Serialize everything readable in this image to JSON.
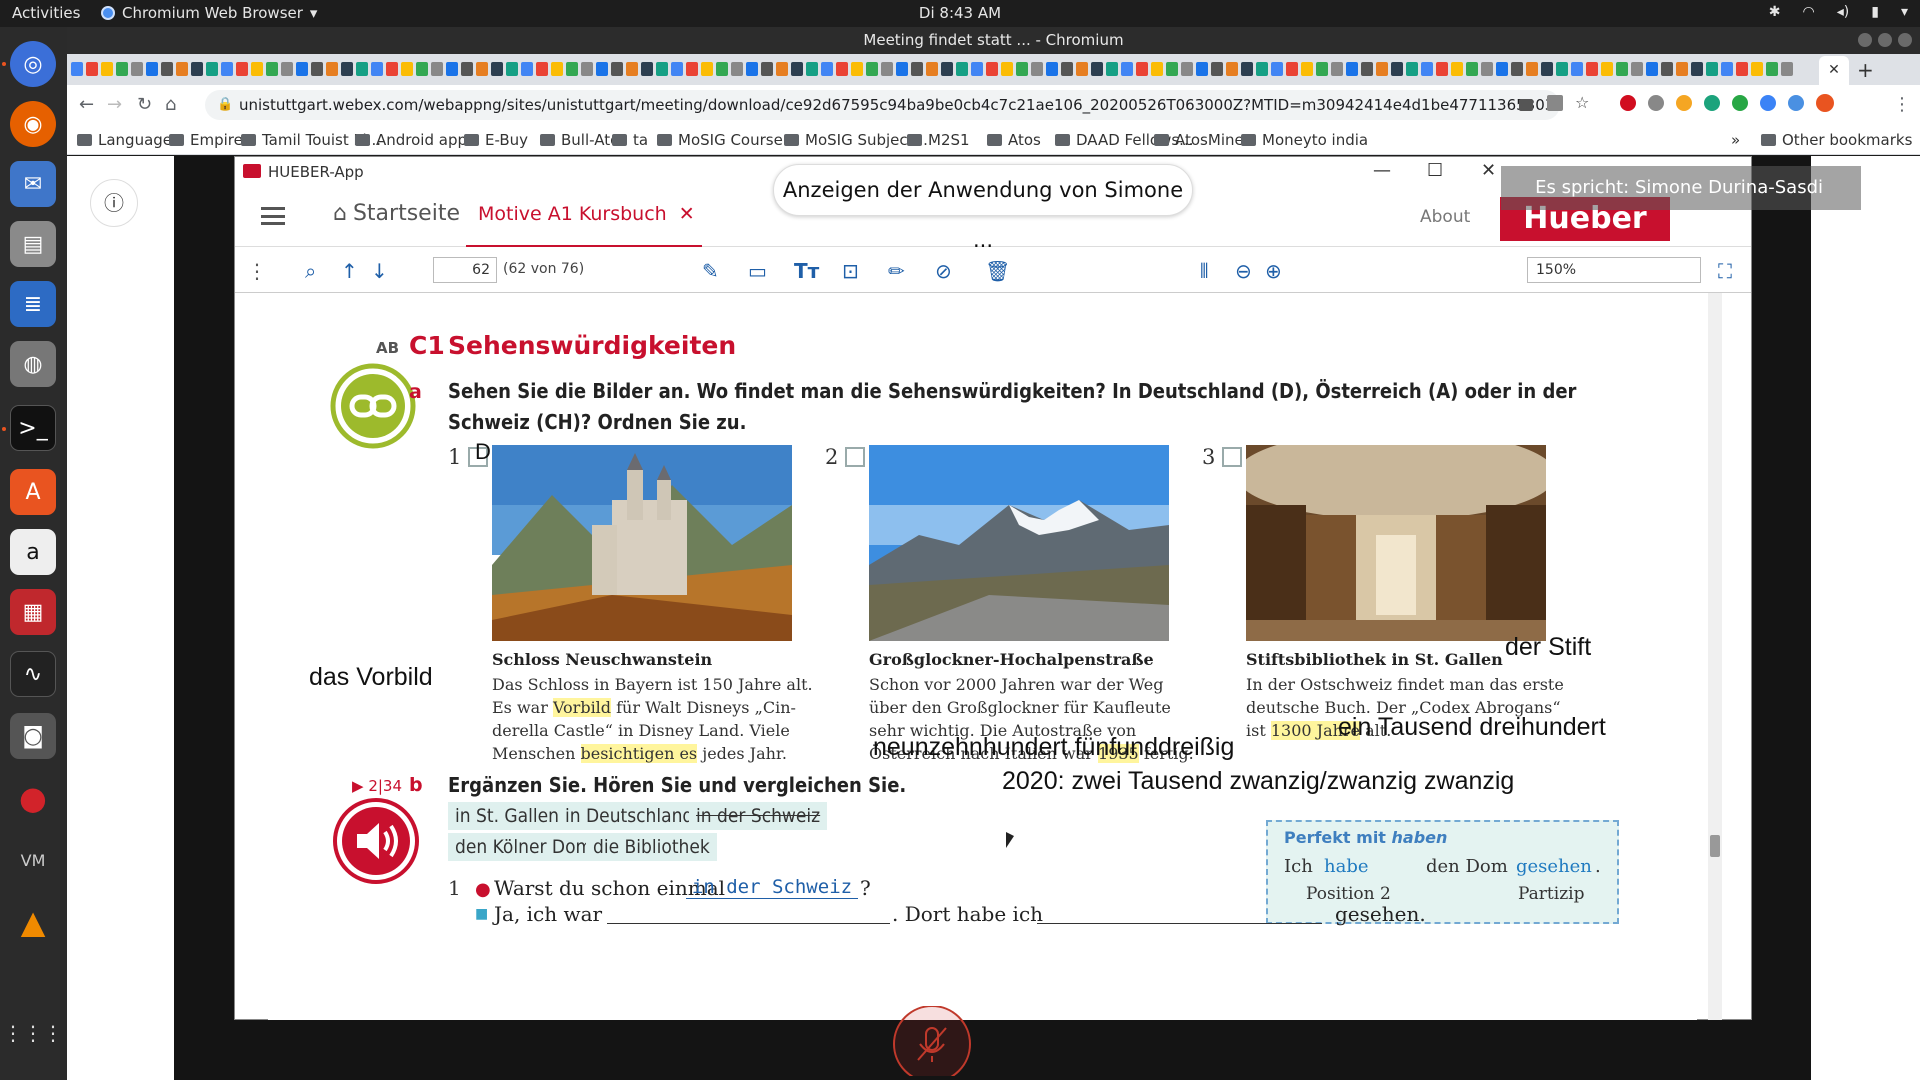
{
  "topbar": {
    "activities": "Activities",
    "app_menu": "Chromium Web Browser",
    "clock": "Di  8:43 AM"
  },
  "browser": {
    "window_title": "Meeting findet statt ... - Chromium",
    "url": "unistuttgart.webex.com/webappng/sites/unistuttgart/meeting/download/ce92d67595c94ba9be0cb4c7c21ae106_20200526T063000Z?MTID=m30942414e4d1be477113653036162165&launchApp...",
    "bookmarks": [
      "Language",
      "Empire",
      "Tamil Touist Pl...",
      "Android apps",
      "E-Buy",
      "Bull-Atos",
      "ta",
      "MoSIG Course...",
      "MoSIG Subject...",
      "M2S1",
      "Atos",
      "DAAD Fellows...",
      "AtosMine",
      "Moneyto india"
    ],
    "more_bookmarks": "»",
    "other_bookmarks": "Other bookmarks"
  },
  "share": {
    "notice": "Anzeigen der Anwendung von Simone ...",
    "speaker": "Es spricht: Simone Durina-Sasdi"
  },
  "hueber": {
    "title": "HUEBER-App",
    "home": "Startseite",
    "tab": "Motive A1 Kursbuch",
    "about": "About",
    "logo": "Hueber",
    "page_current": "62",
    "page_total": "(62 von 76)",
    "zoom": "150%"
  },
  "exercise": {
    "ab": "AB",
    "c1": "C1",
    "heading": "Sehenswürdigkeiten",
    "a_label": "a",
    "instruction_line1": "Sehen Sie die Bilder an. Wo findet man die Sehenswürdigkeiten? In Deutschland (D), Österreich (A) oder in der",
    "instruction_line2": "Schweiz (CH)? Ordnen Sie zu.",
    "items": [
      {
        "number": "1",
        "answer": "D",
        "caption_title": "Schloss Neuschwanstein",
        "line1": "Das Schloss in Bayern ist 150 Jahre alt.",
        "line2a": "Es war ",
        "line2hi": "Vorbild",
        "line2b": " für Walt Disneys „Cin-",
        "line3": "derella Castle“ in Disney Land. Viele",
        "line4a": "Menschen ",
        "line4hi": "besichtigen es",
        "line4b": " jedes Jahr."
      },
      {
        "number": "2",
        "answer": "",
        "caption_title": "Großglockner-Hochalpenstraße",
        "line1": "Schon vor 2000 Jahren war der Weg",
        "line2": "über den Großglockner für Kaufleute",
        "line3": "sehr wichtig. Die Autostraße von",
        "line4a": "Österreich nach Italien war ",
        "line4hi": "1935",
        "line4b": " fertig."
      },
      {
        "number": "3",
        "answer": "",
        "caption_title": "Stiftsbibliothek in St. Gallen",
        "line1": "In der Ostschweiz findet man das erste",
        "line2": "deutsche Buch. Der „Codex Abrogans“",
        "line3a": "ist ",
        "line3hi": "1300 Jahre",
        "line3b": " alt."
      }
    ],
    "b_ref": "2|34",
    "b_label": "b",
    "b_instruction": "Ergänzen Sie. Hören Sie und vergleichen Sie.",
    "chips": [
      "in St. Gallen",
      "in Deutschland",
      "in der Schweiz",
      "den Kölner Dom",
      "die Bibliothek"
    ],
    "grammar_title_a": "Perfekt mit ",
    "grammar_title_b": "haben",
    "grammar_ich": "Ich",
    "grammar_habe": "habe",
    "grammar_dom": "den Dom",
    "grammar_gesehen": "gesehen",
    "grammar_dot": ".",
    "grammar_pos2": "Position 2",
    "grammar_partizip": "Partizip",
    "q_number": "1",
    "q1_text": "Warst du schon einmal",
    "q1_answer": "in der Schweiz",
    "q1_end": "?",
    "a1_start": "Ja, ich war",
    "a1_mid": ". Dort habe ich",
    "a1_end": "gesehen."
  },
  "annotations": {
    "vorbild": "das Vorbild",
    "stift": "der Stift",
    "tausend": "ein Tausend dreihundert",
    "neunzehn": "neunzehnhundert fünfunddreißig",
    "year2020": "2020: zwei Tausend zwanzig/zwanzig zwanzig"
  },
  "colors": {
    "accent_red": "#c8102e",
    "link_blue": "#1f5fa8",
    "chip_teal": "#dff0ee",
    "green": "#9dba2c"
  }
}
